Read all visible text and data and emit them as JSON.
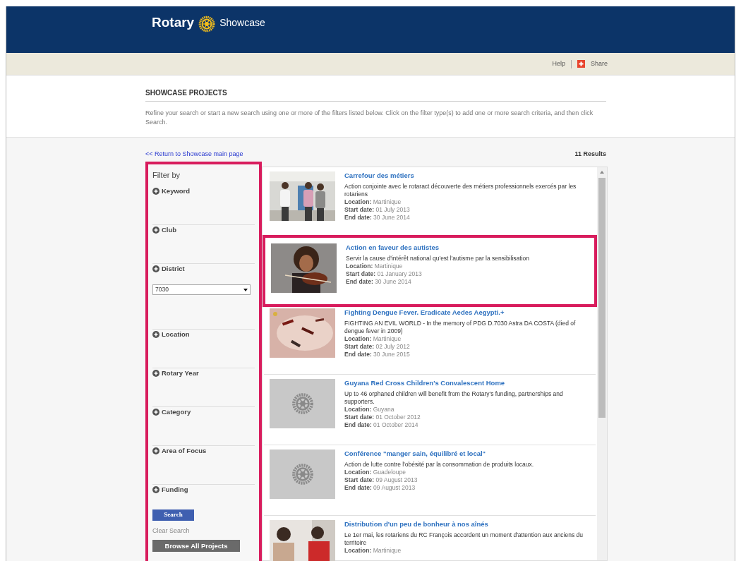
{
  "header": {
    "brand": "Rotary",
    "product": "Showcase"
  },
  "toolbar": {
    "help": "Help",
    "share": "Share"
  },
  "intro": {
    "title": "SHOWCASE PROJECTS",
    "text": "Refine your search or start a new search using one or more of the filters listed below. Click on the filter type(s) to add one or more search criteria, and then click Search."
  },
  "return_link": "<< Return to Showcase main page",
  "results_count": "11 Results",
  "sidebar": {
    "title": "Filter by",
    "highlighted": true,
    "filters": [
      {
        "label": "Keyword"
      },
      {
        "label": "Club"
      },
      {
        "label": "District",
        "value": "7030"
      },
      {
        "label": "Location"
      },
      {
        "label": "Rotary Year"
      },
      {
        "label": "Category"
      },
      {
        "label": "Area of Focus"
      },
      {
        "label": "Funding"
      }
    ],
    "search_button": "Search",
    "clear_search": "Clear Search",
    "browse_button": "Browse All Projects"
  },
  "results": [
    {
      "highlighted": false,
      "title": "Carrefour des métiers",
      "description": "Action conjointe avec le rotaract découverte des métiers professionnels exercés par les rotariens",
      "location_label": "Location:",
      "location": "Martinique",
      "start_label": "Start date:",
      "start": "01 July 2013",
      "end_label": "End date:",
      "end": "30 June 2014"
    },
    {
      "highlighted": true,
      "title": "Action en faveur des autistes",
      "description": "Servir la cause d'intérêt national qu'est l'autisme par la sensibilisation",
      "location_label": "Location:",
      "location": "Martinique",
      "start_label": "Start date:",
      "start": "01 January 2013",
      "end_label": "End date:",
      "end": "30 June 2014"
    },
    {
      "highlighted": false,
      "title": "Fighting Dengue Fever. Eradicate Aedes Aegypti.+",
      "description": "FIGHTING AN EVIL WORLD - In the memory of PDG D.7030 Astra DA COSTA (died of dengue fever in 2009)",
      "location_label": "Location:",
      "location": "Martinique",
      "start_label": "Start date:",
      "start": "02 July 2012",
      "end_label": "End date:",
      "end": "30 June 2015"
    },
    {
      "kind": "placeholder",
      "highlighted": false,
      "title": "Guyana Red Cross Children's Convalescent Home",
      "description": "Up to 46 orphaned children will benefit from the Rotary's funding, partnerships and supporters.",
      "location_label": "Location:",
      "location": "Guyana",
      "start_label": "Start date:",
      "start": "01 October 2012",
      "end_label": "End date:",
      "end": "01 October 2014"
    },
    {
      "kind": "placeholder",
      "highlighted": false,
      "title": "Conférence \"manger sain, équilibré et local\"",
      "description": "Action de lutte contre l'obésité par la consommation de produits locaux.",
      "location_label": "Location:",
      "location": "Guadeloupe",
      "start_label": "Start date:",
      "start": "09 August 2013",
      "end_label": "End date:",
      "end": "09 August 2013"
    },
    {
      "highlighted": false,
      "title": "Distribution d'un peu de bonheur à nos aînés",
      "description": "Le 1er mai, les rotariens du RC François accordent un moment d'attention aux anciens du territoire",
      "location_label": "Location:",
      "location": "Martinique"
    }
  ]
}
